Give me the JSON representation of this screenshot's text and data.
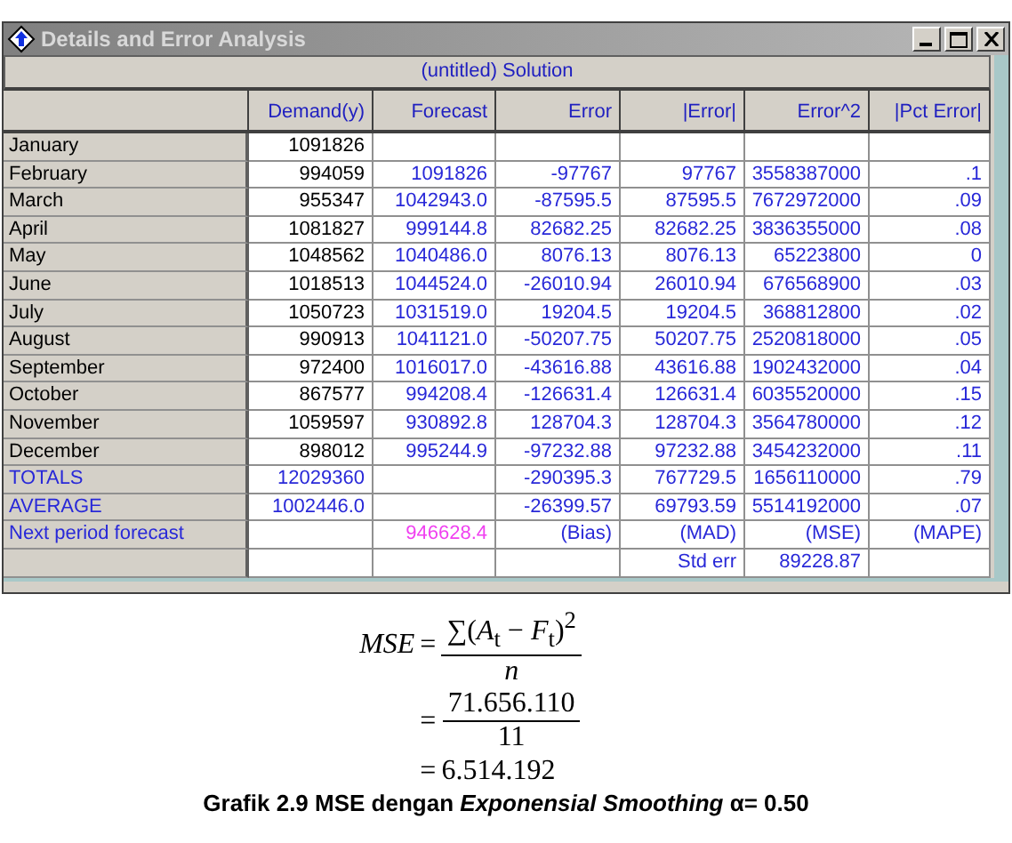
{
  "window": {
    "title": "Details and Error Analysis"
  },
  "table": {
    "title": "(untitled) Solution",
    "columns": [
      {
        "label": "Demand(y)",
        "kind": "input"
      },
      {
        "label": "Forecast",
        "kind": "computed"
      },
      {
        "label": "Error",
        "kind": "computed"
      },
      {
        "label": "|Error|",
        "kind": "computed"
      },
      {
        "label": "Error^2",
        "kind": "computed"
      },
      {
        "label": "|Pct Error|",
        "kind": "computed"
      }
    ],
    "rows": [
      {
        "label": "January",
        "kind": "month",
        "cells": [
          "1091826",
          null,
          null,
          null,
          null,
          null
        ]
      },
      {
        "label": "February",
        "kind": "month",
        "cells": [
          "994059",
          "1091826",
          "-97767",
          "97767",
          "3558387000",
          ".1"
        ]
      },
      {
        "label": "March",
        "kind": "month",
        "cells": [
          "955347",
          "1042943.0",
          "-87595.5",
          "87595.5",
          "7672972000",
          ".09"
        ]
      },
      {
        "label": "April",
        "kind": "month",
        "cells": [
          "1081827",
          "999144.8",
          "82682.25",
          "82682.25",
          "3836355000",
          ".08"
        ]
      },
      {
        "label": "May",
        "kind": "month",
        "cells": [
          "1048562",
          "1040486.0",
          "8076.13",
          "8076.13",
          "65223800",
          "0"
        ]
      },
      {
        "label": "June",
        "kind": "month",
        "cells": [
          "1018513",
          "1044524.0",
          "-26010.94",
          "26010.94",
          "676568900",
          ".03"
        ]
      },
      {
        "label": "July",
        "kind": "month",
        "cells": [
          "1050723",
          "1031519.0",
          "19204.5",
          "19204.5",
          "368812800",
          ".02"
        ]
      },
      {
        "label": "August",
        "kind": "month",
        "cells": [
          "990913",
          "1041121.0",
          "-50207.75",
          "50207.75",
          "2520818000",
          ".05"
        ]
      },
      {
        "label": "September",
        "kind": "month",
        "cells": [
          "972400",
          "1016017.0",
          "-43616.88",
          "43616.88",
          "1902432000",
          ".04"
        ]
      },
      {
        "label": "October",
        "kind": "month",
        "cells": [
          "867577",
          "994208.4",
          "-126631.4",
          "126631.4",
          "6035520000",
          ".15"
        ]
      },
      {
        "label": "November",
        "kind": "month",
        "cells": [
          "1059597",
          "930892.8",
          "128704.3",
          "128704.3",
          "3564780000",
          ".12"
        ]
      },
      {
        "label": "December",
        "kind": "month",
        "cells": [
          "898012",
          "995244.9",
          "-97232.88",
          "97232.88",
          "3454232000",
          ".11"
        ]
      },
      {
        "label": "TOTALS",
        "kind": "summary",
        "cells": [
          "12029360",
          null,
          "-290395.3",
          "767729.5",
          "1656110000",
          ".79"
        ]
      },
      {
        "label": "AVERAGE",
        "kind": "summary",
        "cells": [
          "1002446.0",
          null,
          "-26399.57",
          "69793.59",
          "5514192000",
          ".07"
        ]
      },
      {
        "label": "Next period forecast",
        "kind": "forecast",
        "cells": [
          null,
          "946628.4",
          "(Bias)",
          "(MAD)",
          "(MSE)",
          "(MAPE)"
        ]
      },
      {
        "kind": "stat",
        "cells": [
          null,
          null,
          null,
          "Std err",
          "89228.87",
          null
        ]
      }
    ]
  },
  "formula": {
    "lhs": "MSE",
    "steps": [
      {
        "kind": "fraction",
        "relation": "=",
        "numerator": "∑(*A*$_{t}$ − *F*$_{t}$)$^{2}$",
        "denominator": "*n*"
      },
      {
        "kind": "fraction",
        "relation": "=",
        "numerator": "71.656.110",
        "denominator": "11"
      },
      {
        "kind": "value",
        "relation": "=",
        "text": "6.514.192"
      }
    ]
  },
  "caption": "Grafik 2.9 MSE dengan *Exponensial Smoothing* α= 0.50"
}
